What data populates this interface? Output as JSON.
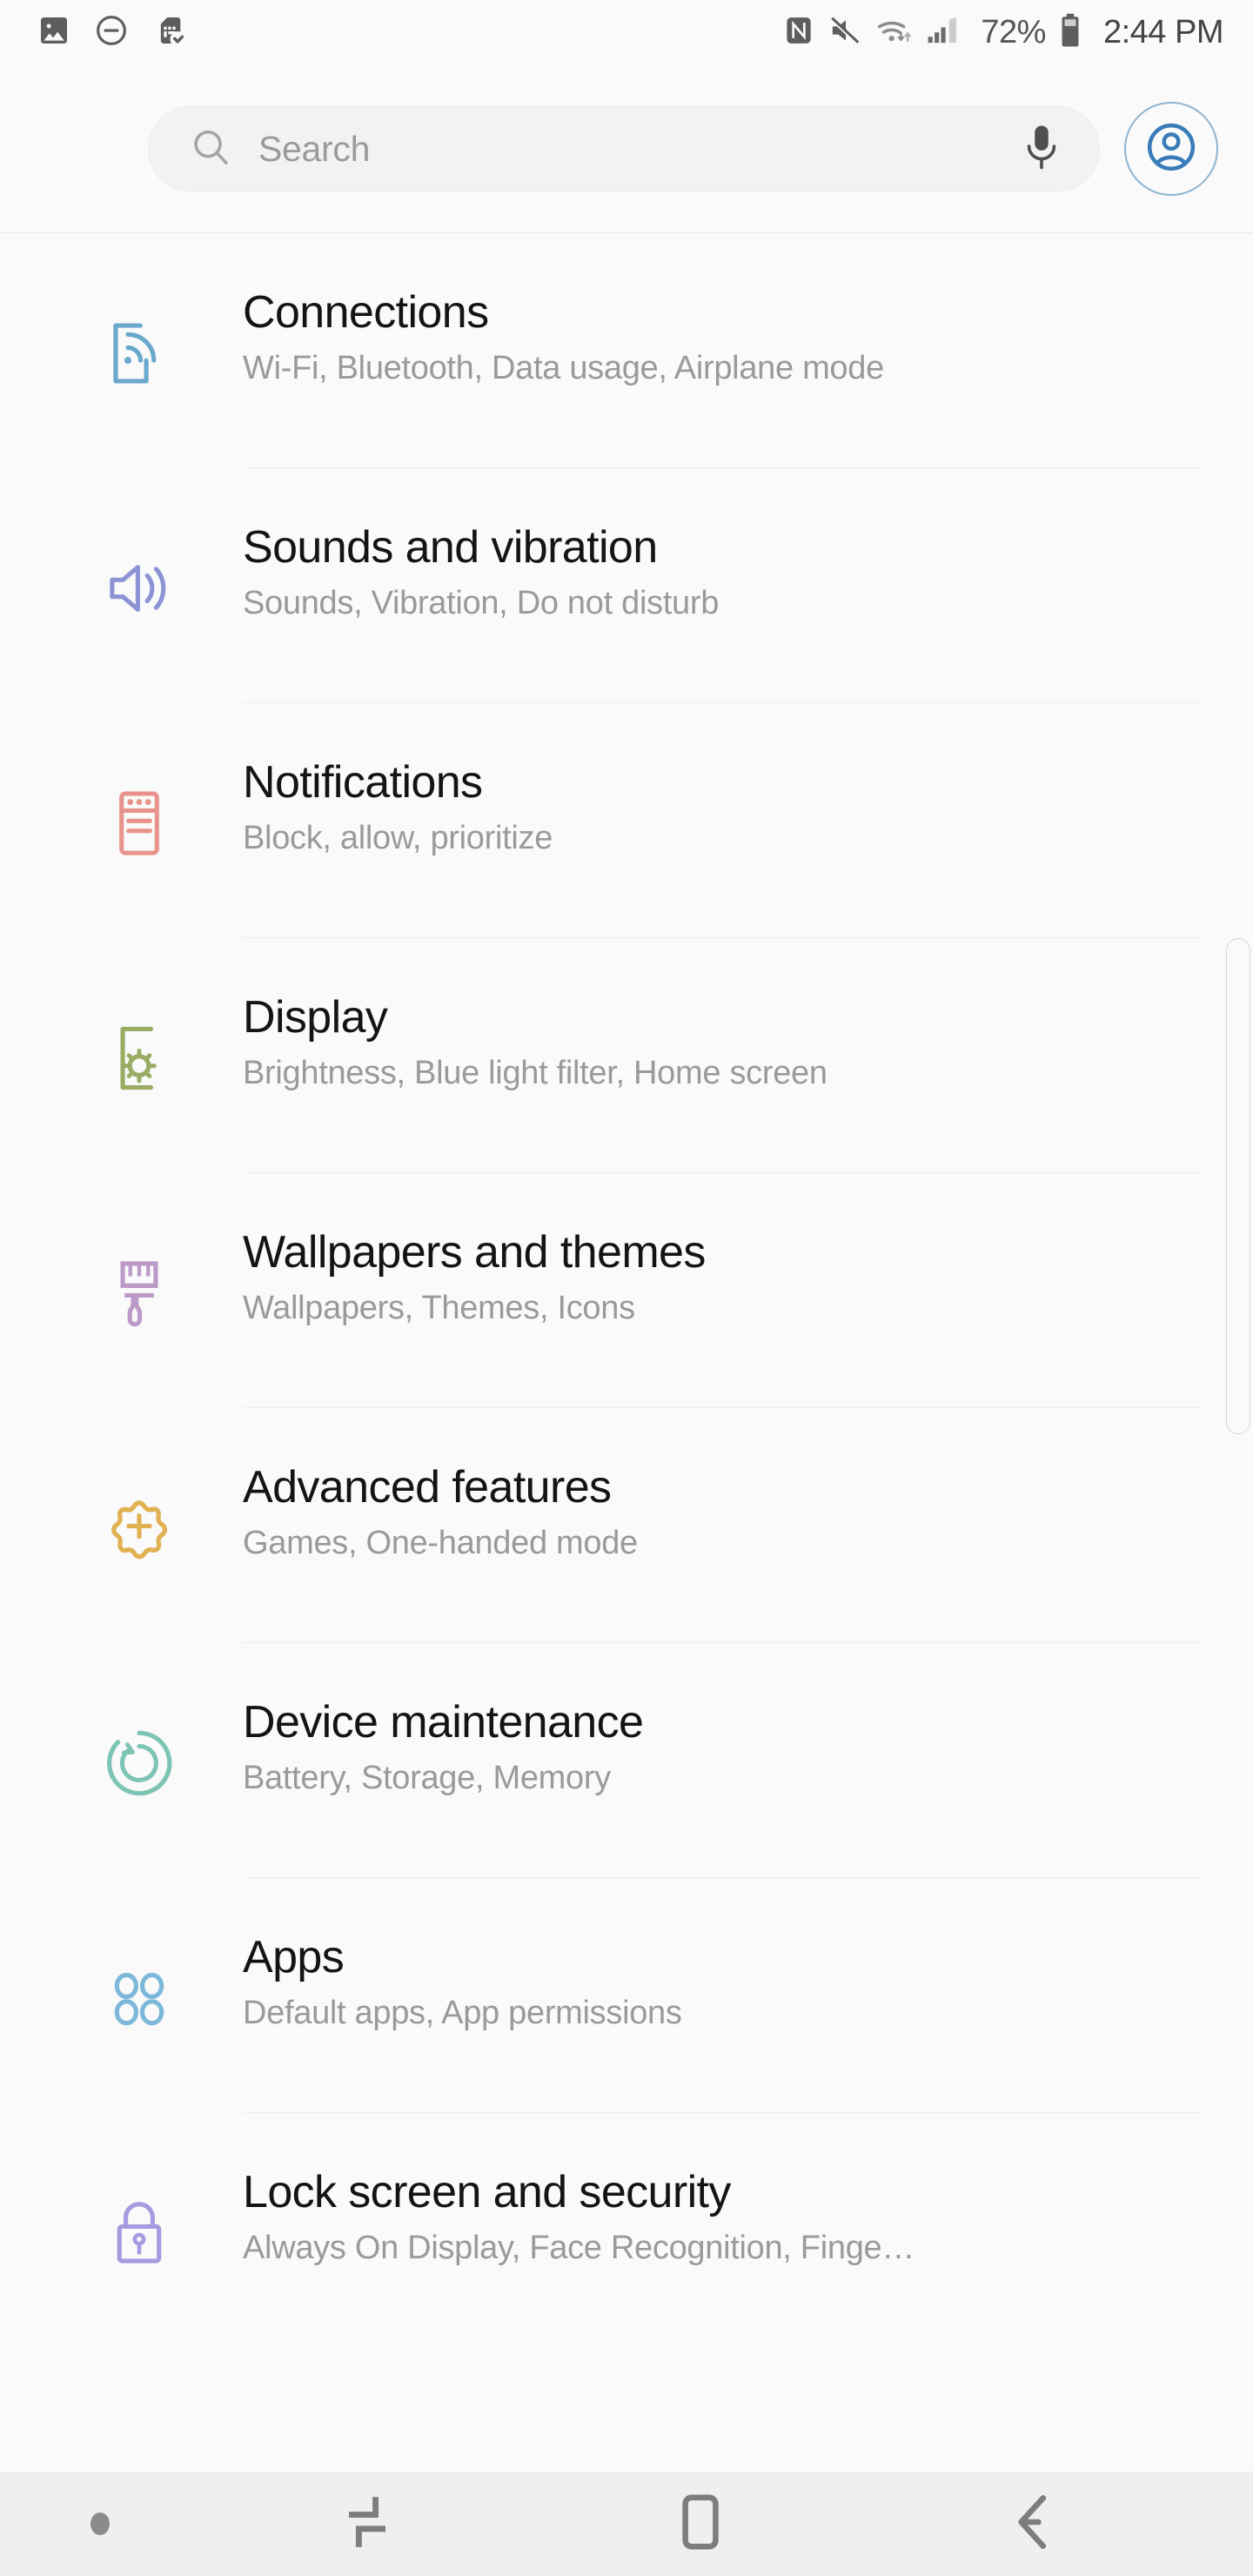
{
  "status_bar": {
    "left_icons": [
      {
        "name": "screenshot-image-icon",
        "label": "Image"
      },
      {
        "name": "do-not-disturb-icon",
        "label": "Do not disturb"
      },
      {
        "name": "sim-card-off-icon",
        "label": "No SIM"
      }
    ],
    "right_icons": [
      {
        "name": "nfc-icon",
        "label": "NFC"
      },
      {
        "name": "mute-icon",
        "label": "Sound off"
      },
      {
        "name": "wifi-icon",
        "label": "Wi-Fi"
      },
      {
        "name": "signal-bars-icon",
        "label": "Mobile signal"
      }
    ],
    "battery_percent": "72%",
    "time": "2:44 PM"
  },
  "search": {
    "placeholder": "Search",
    "value": "",
    "mic_label": "Voice search",
    "account_label": "Samsung account"
  },
  "settings": {
    "items": [
      {
        "title": "Connections",
        "subtitle": "Wi-Fi, Bluetooth, Data usage, Airplane mode",
        "icon": "connections-icon",
        "color": "#6aa9cc"
      },
      {
        "title": "Sounds and vibration",
        "subtitle": "Sounds, Vibration, Do not disturb",
        "icon": "sounds-vibration-icon",
        "color": "#8b93d4"
      },
      {
        "title": "Notifications",
        "subtitle": "Block, allow, prioritize",
        "icon": "notifications-icon",
        "color": "#e8948c"
      },
      {
        "title": "Display",
        "subtitle": "Brightness, Blue light filter, Home screen",
        "icon": "display-icon",
        "color": "#9aab63"
      },
      {
        "title": "Wallpapers and themes",
        "subtitle": "Wallpapers, Themes, Icons",
        "icon": "wallpapers-themes-icon",
        "color": "#bc9ac8"
      },
      {
        "title": "Advanced features",
        "subtitle": "Games, One-handed mode",
        "icon": "advanced-features-icon",
        "color": "#e0b152"
      },
      {
        "title": "Device maintenance",
        "subtitle": "Battery, Storage, Memory",
        "icon": "device-maintenance-icon",
        "color": "#7cc4b4"
      },
      {
        "title": "Apps",
        "subtitle": "Default apps, App permissions",
        "icon": "apps-icon",
        "color": "#7cb8d9"
      },
      {
        "title": "Lock screen and security",
        "subtitle": "Always On Display, Face Recognition, Finge…",
        "icon": "lock-screen-security-icon",
        "color": "#a79ae0"
      }
    ]
  },
  "navigation_bar": {
    "recents_label": "Recents",
    "home_label": "Home",
    "back_label": "Back"
  }
}
